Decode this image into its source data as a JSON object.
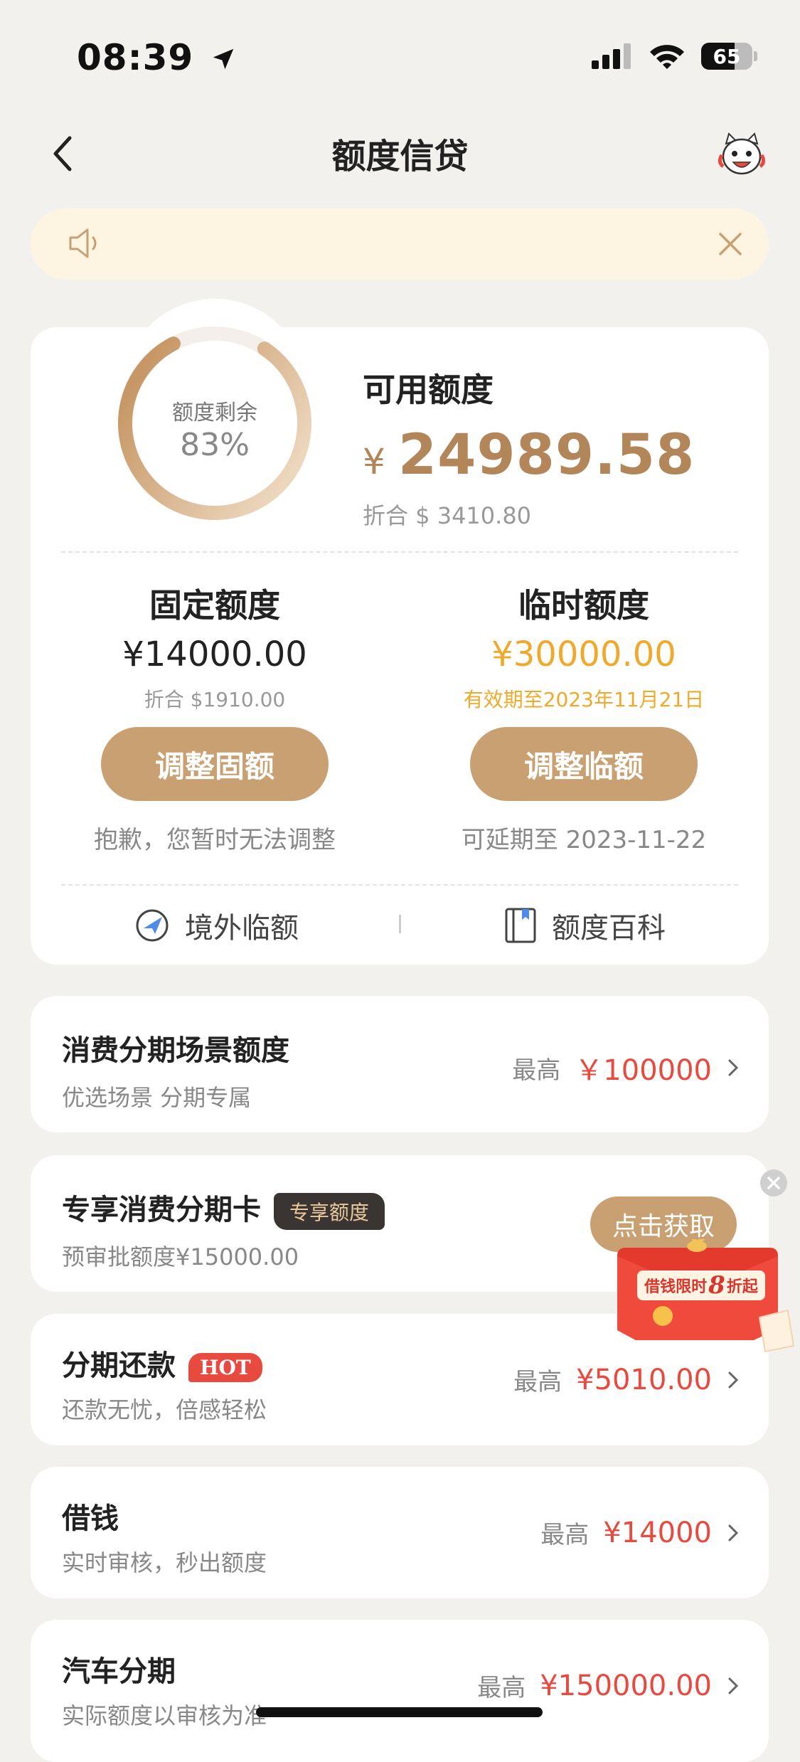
{
  "status_bar": {
    "time": "08:39",
    "battery": "65",
    "battery_level": 0.65
  },
  "header": {
    "title": "额度信贷"
  },
  "quota_card": {
    "ring_label": "额度剩余",
    "ring_percent": "83%",
    "ring_fraction": 0.83,
    "available_label": "可用额度",
    "currency_symbol": "¥",
    "available_amount": "24989.58",
    "available_converted": "折合 $ 3410.80",
    "fixed": {
      "title": "固定额度",
      "amount": "¥14000.00",
      "sub": "折合 $1910.00",
      "button": "调整固额",
      "note": "抱歉，您暂时无法调整"
    },
    "temp": {
      "title": "临时额度",
      "amount": "¥30000.00",
      "sub": "有效期至2023年11月21日",
      "button": "调整临额",
      "note": "可延期至 2023-11-22"
    },
    "links": {
      "overseas": "境外临额",
      "encyclopedia": "额度百科"
    }
  },
  "list": [
    {
      "title": "消费分期场景额度",
      "subtitle": "优选场景 分期专属",
      "prefix": "最高",
      "value": "￥100000"
    },
    {
      "title": "专享消费分期卡",
      "tag": "专享额度",
      "subtitle": "预审批额度¥15000.00",
      "button": "点击获取"
    },
    {
      "title": "分期还款",
      "tag": "HOT",
      "subtitle": "还款无忧，倍感轻松",
      "prefix": "最高",
      "value": "¥5010.00"
    },
    {
      "title": "借钱",
      "subtitle": "实时审核，秒出额度",
      "prefix": "最高",
      "value": "¥14000"
    },
    {
      "title": "汽车分期",
      "subtitle": "实际额度以审核为准",
      "prefix": "最高",
      "value": "¥150000.00"
    }
  ],
  "promo": {
    "text": "借钱限时",
    "num": "8",
    "suffix": "折起"
  },
  "colors": {
    "accent": "#c9a071",
    "gold_text": "#b3865a",
    "temp_amount": "#f0a92a",
    "red": "#e84a3f"
  },
  "icons": [
    "location-arrow-icon",
    "signal-icon",
    "wifi-icon",
    "back-arrow-icon",
    "mascot-icon",
    "speaker-icon",
    "close-icon",
    "plane-icon",
    "book-icon",
    "chevron-right-icon"
  ]
}
